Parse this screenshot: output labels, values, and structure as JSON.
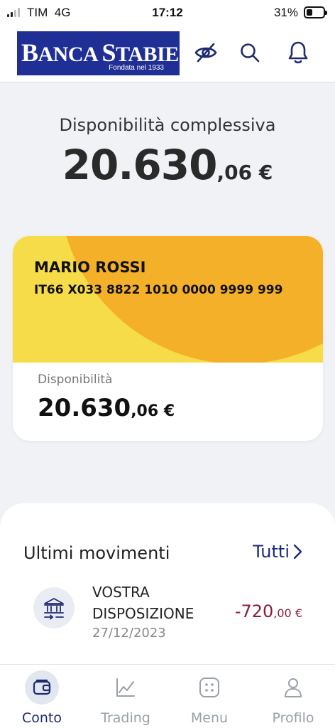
{
  "status_bar": {
    "carrier": "TIM",
    "network": "4G",
    "time": "17:12",
    "battery": "31%",
    "battery_level": 0.31,
    "signal_bars": 2
  },
  "header": {
    "logo_name": "Banca Stabiese",
    "logo_tagline": "Fondata nel 1933",
    "icons": [
      "eye-off-icon",
      "search-icon",
      "bell-icon"
    ]
  },
  "summary": {
    "label": "Disponibilità complessiva",
    "amount_int": "20.630",
    "amount_dec": ",06 €"
  },
  "account": {
    "holder": "MARIO ROSSI",
    "iban": "IT66 X033 8822 1010 0000 9999 999",
    "available_label": "Disponibilità",
    "available_int": "20.630",
    "available_dec": ",06 €"
  },
  "movements": {
    "title": "Ultimi movimenti",
    "see_all": "Tutti",
    "items": [
      {
        "icon": "bank-transfer-icon",
        "description": "Vostra disposizione",
        "date": "27/12/2023",
        "amount_int": "-720",
        "amount_dec": ",00 €"
      }
    ]
  },
  "nav": {
    "items": [
      {
        "label": "Conto",
        "icon": "wallet-icon",
        "active": true
      },
      {
        "label": "Trading",
        "icon": "chart-icon",
        "active": false
      },
      {
        "label": "Menu",
        "icon": "menu-dots-icon",
        "active": false
      },
      {
        "label": "Profilo",
        "icon": "user-icon",
        "active": false
      }
    ]
  },
  "colors": {
    "brand_blue": "#1f2f95",
    "accent_navy": "#1d2a72",
    "card_yellow": "#f7dc4a",
    "card_orange": "#f5b02a",
    "negative_amount": "#8b1d3a"
  }
}
